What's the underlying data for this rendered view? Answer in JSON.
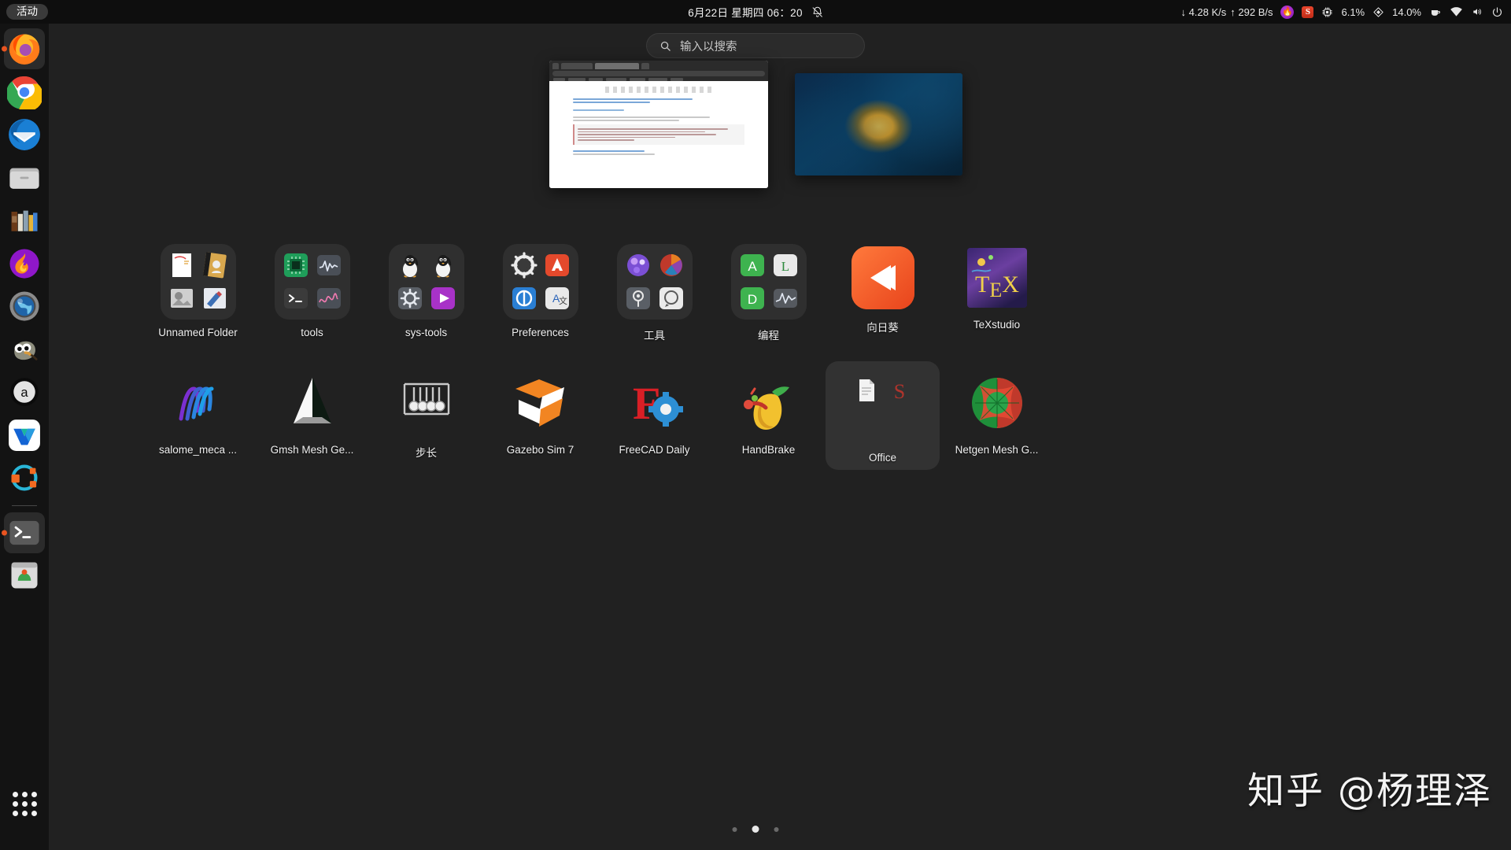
{
  "topbar": {
    "activities_label": "活动",
    "clock": "6月22日 星期四  06：20",
    "notifications_icon": "bell-off-icon",
    "net_down": "↓ 4.28 K/s",
    "net_up": "↑ 292 B/s",
    "cpu_value": "6.1%",
    "mem_value": "14.0%",
    "tray_icons": [
      "flameshot-icon",
      "snipaste-icon",
      "cpu-icon",
      "memory-icon",
      "caffeine-icon",
      "wifi-icon",
      "volume-icon",
      "power-icon"
    ]
  },
  "search": {
    "placeholder": "输入以搜索",
    "icon": "search-icon"
  },
  "windows": [
    {
      "name": "browser-window-preview",
      "type": "browser"
    },
    {
      "name": "image-viewer-window-preview",
      "type": "photo"
    }
  ],
  "dock": {
    "items": [
      {
        "name": "firefox",
        "icon": "firefox-icon",
        "running": true
      },
      {
        "name": "google-chrome",
        "icon": "chrome-icon",
        "running": false
      },
      {
        "name": "thunderbird",
        "icon": "thunderbird-icon",
        "running": false
      },
      {
        "name": "files",
        "icon": "folder-icon",
        "running": false
      },
      {
        "name": "calibre",
        "icon": "books-icon",
        "running": false
      },
      {
        "name": "flameshot",
        "icon": "flame-icon",
        "running": false
      },
      {
        "name": "web-browser",
        "icon": "globe-lens-icon",
        "running": false
      },
      {
        "name": "gimp",
        "icon": "gimp-icon",
        "running": false
      },
      {
        "name": "anaconda",
        "icon": "anaconda-icon",
        "running": false
      },
      {
        "name": "wps-office",
        "icon": "wps-icon",
        "running": false
      },
      {
        "name": "app-ring",
        "icon": "ring-icon",
        "running": false
      },
      {
        "name": "terminal",
        "icon": "terminal-icon",
        "running": true
      },
      {
        "name": "ubuntu-software",
        "icon": "software-icon",
        "running": false
      }
    ],
    "apps_button": "show-applications-icon"
  },
  "grid": {
    "row1": [
      {
        "label": "Unnamed Folder",
        "kind": "folder",
        "icon": "unnamed-folder-icon"
      },
      {
        "label": "tools",
        "kind": "folder",
        "icon": "tools-folder-icon"
      },
      {
        "label": "sys-tools",
        "kind": "folder",
        "icon": "sys-tools-folder-icon"
      },
      {
        "label": "Preferences",
        "kind": "folder",
        "icon": "preferences-folder-icon"
      },
      {
        "label": "工具",
        "kind": "folder",
        "icon": "gongju-folder-icon"
      },
      {
        "label": "编程",
        "kind": "folder",
        "icon": "biancheng-folder-icon"
      },
      {
        "label": "向日葵",
        "kind": "app",
        "icon": "sunlogin-icon"
      },
      {
        "label": "TeXstudio",
        "kind": "app",
        "icon": "texstudio-icon"
      }
    ],
    "row2": [
      {
        "label": "salome_meca ...",
        "kind": "app",
        "icon": "salome-meca-icon"
      },
      {
        "label": "Gmsh Mesh Ge...",
        "kind": "app",
        "icon": "gmsh-icon"
      },
      {
        "label": "步长",
        "kind": "app",
        "icon": "buchang-icon"
      },
      {
        "label": "Gazebo Sim 7",
        "kind": "app",
        "icon": "gazebo-icon"
      },
      {
        "label": "FreeCAD Daily",
        "kind": "app",
        "icon": "freecad-icon"
      },
      {
        "label": "HandBrake",
        "kind": "app",
        "icon": "handbrake-icon"
      },
      {
        "label": "Office",
        "kind": "folder",
        "icon": "office-folder-icon",
        "selected": true
      },
      {
        "label": "Netgen Mesh G...",
        "kind": "app",
        "icon": "netgen-icon"
      }
    ]
  },
  "pagination": {
    "pages": 3,
    "current": 2
  },
  "watermark": "知乎 @杨理泽",
  "colors": {
    "accent": "#e95420",
    "bg": "#212121",
    "topbar": "#0e0e0e",
    "dock": "#131313"
  }
}
